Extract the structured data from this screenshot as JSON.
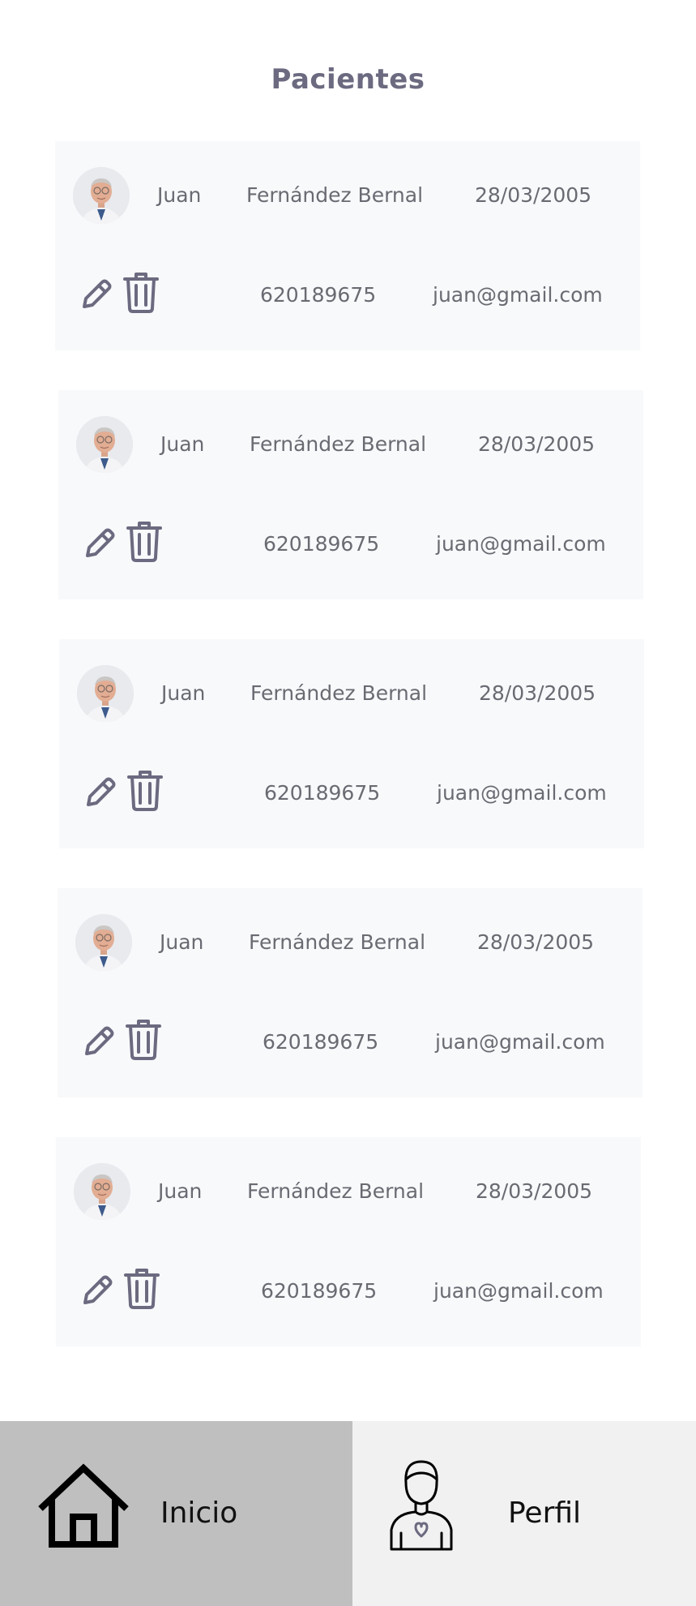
{
  "page": {
    "title": "Pacientes"
  },
  "patients": [
    {
      "first_name": "Juan",
      "last_name": "Fernández Bernal",
      "birth_date": "28/03/2005",
      "phone": "620189675",
      "email": "juan@gmail.com"
    },
    {
      "first_name": "Juan",
      "last_name": "Fernández Bernal",
      "birth_date": "28/03/2005",
      "phone": "620189675",
      "email": "juan@gmail.com"
    },
    {
      "first_name": "Juan",
      "last_name": "Fernández Bernal",
      "birth_date": "28/03/2005",
      "phone": "620189675",
      "email": "juan@gmail.com"
    },
    {
      "first_name": "Juan",
      "last_name": "Fernández Bernal",
      "birth_date": "28/03/2005",
      "phone": "620189675",
      "email": "juan@gmail.com"
    },
    {
      "first_name": "Juan",
      "last_name": "Fernández Bernal",
      "birth_date": "28/03/2005",
      "phone": "620189675",
      "email": "juan@gmail.com"
    }
  ],
  "actions": {
    "edit_icon": "pencil-icon",
    "delete_icon": "trash-icon"
  },
  "nav": {
    "home": {
      "label": "Inicio",
      "icon": "home-icon",
      "active": true
    },
    "profile": {
      "label": "Perfil",
      "icon": "user-heart-icon",
      "active": false
    }
  },
  "colors": {
    "title": "#6b6a80",
    "card_background": "#f8f9fb",
    "text": "#6a6a72",
    "icon": "#6b6a80",
    "nav_active": "#bfbfbf",
    "nav_inactive": "#f1f1f1"
  }
}
